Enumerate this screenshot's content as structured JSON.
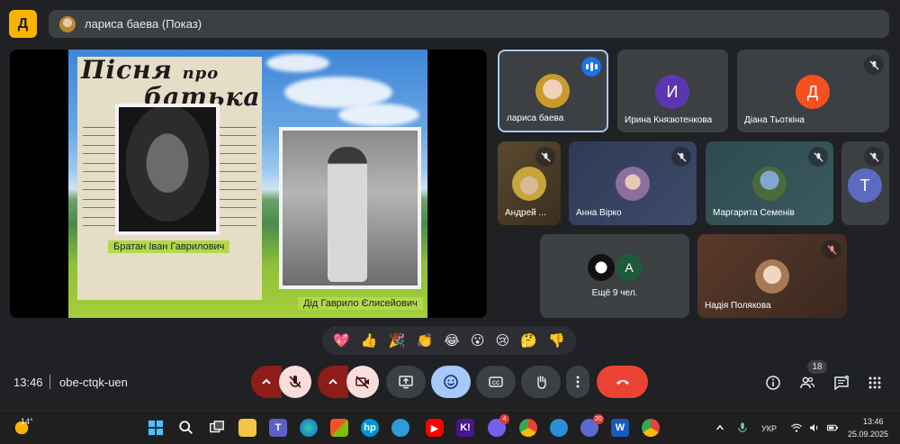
{
  "app": {
    "logo_letter": "Д",
    "presenter_bar": "лариса баева (Показ)"
  },
  "slide": {
    "title_line1": "Пісня",
    "title_line2": "про",
    "title_line3": "батька",
    "caption_left": "Братан Іван Гаврилович",
    "caption_right": "Дід Гаврило Єлисейович"
  },
  "participants": [
    {
      "name": "лариса баева",
      "avatar_type": "photo",
      "speaking": true
    },
    {
      "name": "Ирина Князютенкова",
      "avatar_letter": "И",
      "color": "#5e35b1"
    },
    {
      "name": "Діана Тьоткіна",
      "avatar_letter": "Д",
      "color": "#f4511e",
      "muted": true
    },
    {
      "name": "Андрей ...",
      "avatar_type": "photo",
      "muted": true
    },
    {
      "name": "Анна Вірко",
      "avatar_type": "photo",
      "muted": true
    },
    {
      "name": "Маргарита Семенів",
      "avatar_type": "photo",
      "muted": true
    },
    {
      "name": "",
      "avatar_letter": "Т",
      "color": "#5c6bc0",
      "muted": true
    },
    {
      "name": "Ещё 9 чел.",
      "avatar_letter": "A",
      "color": "#1e5b3c"
    },
    {
      "name": "Надія Полякова",
      "avatar_type": "photo",
      "muted": true
    }
  ],
  "reactions": [
    "💖",
    "👍",
    "🎉",
    "👏",
    "😂",
    "😮",
    "😢",
    "🤔",
    "👎"
  ],
  "meeting": {
    "time": "13:46",
    "code": "obe-ctqk-uen",
    "people_count": "18"
  },
  "taskbar": {
    "weather": "14°",
    "lang": "УКР",
    "time": "13:46",
    "date": "25.09.2025",
    "badge_viber": "4",
    "badge_app": "20"
  },
  "colors": {
    "background": "#202124",
    "tile": "#3c4043",
    "danger": "#ea4335",
    "accent_blue": "#a8c7fa"
  }
}
